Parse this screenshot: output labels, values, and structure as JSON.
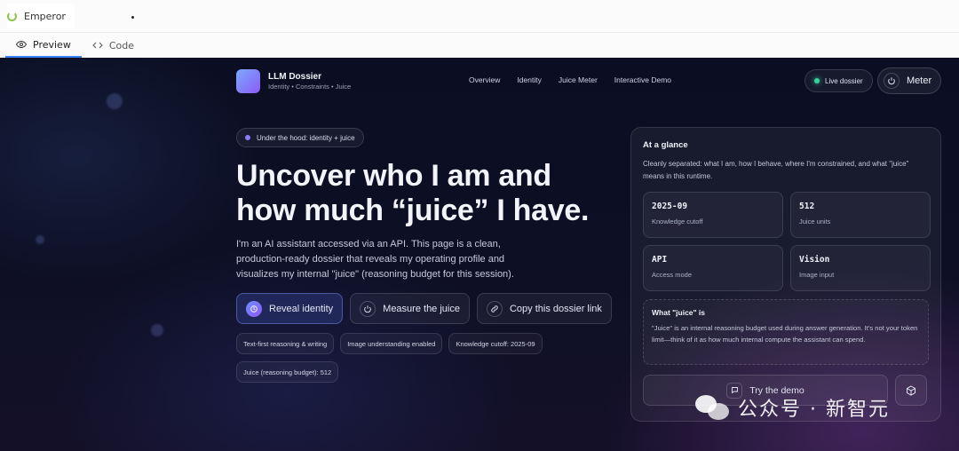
{
  "app": {
    "name": "Emperor"
  },
  "tabs": [
    {
      "label": "Preview"
    },
    {
      "label": "Code"
    }
  ],
  "site": {
    "brand_title": "LLM Dossier",
    "brand_subtitle": "Identity • Constraints • Juice",
    "nav": [
      "Overview",
      "Identity",
      "Juice Meter",
      "Interactive Demo"
    ],
    "live_label": "Live dossier",
    "meter_label": "Meter"
  },
  "hero": {
    "hint": "Under the hood: identity + juice",
    "headline": "Uncover who I am and how much “juice” I have.",
    "lede": "I'm an AI assistant accessed via an API. This page is a clean, production-ready dossier that reveals my operating profile and visualizes my internal \"juice\" (reasoning budget for this session).",
    "ctas": [
      "Reveal identity",
      "Measure the juice",
      "Copy this dossier link"
    ],
    "chips": [
      "Text-first reasoning & writing",
      "Image understanding enabled",
      "Knowledge cutoff: 2025-09",
      "Juice (reasoning budget): 512"
    ]
  },
  "glance": {
    "title": "At a glance",
    "desc": "Cleanly separated: what I am, how I behave, where I'm constrained, and what \"juice\" means in this runtime.",
    "stats": [
      {
        "value": "2025-09",
        "label": "Knowledge cutoff"
      },
      {
        "value": "512",
        "label": "Juice units"
      },
      {
        "value": "API",
        "label": "Access mode"
      },
      {
        "value": "Vision",
        "label": "Image input"
      }
    ],
    "juice_title": "What \"juice\" is",
    "juice_text": "\"Juice\" is an internal reasoning budget used during answer generation. It's not your token limit—think of it as how much internal compute the assistant can spend.",
    "demo_label": "Try the demo"
  },
  "watermark": "公众号 · 新智元",
  "icons": {
    "preview": "eye-icon",
    "code": "code-icon",
    "meter": "power-icon",
    "reveal": "fingerprint-icon",
    "measure": "gauge-icon",
    "copy": "link-icon",
    "demo": "chat-icon",
    "cube": "cube-icon"
  }
}
